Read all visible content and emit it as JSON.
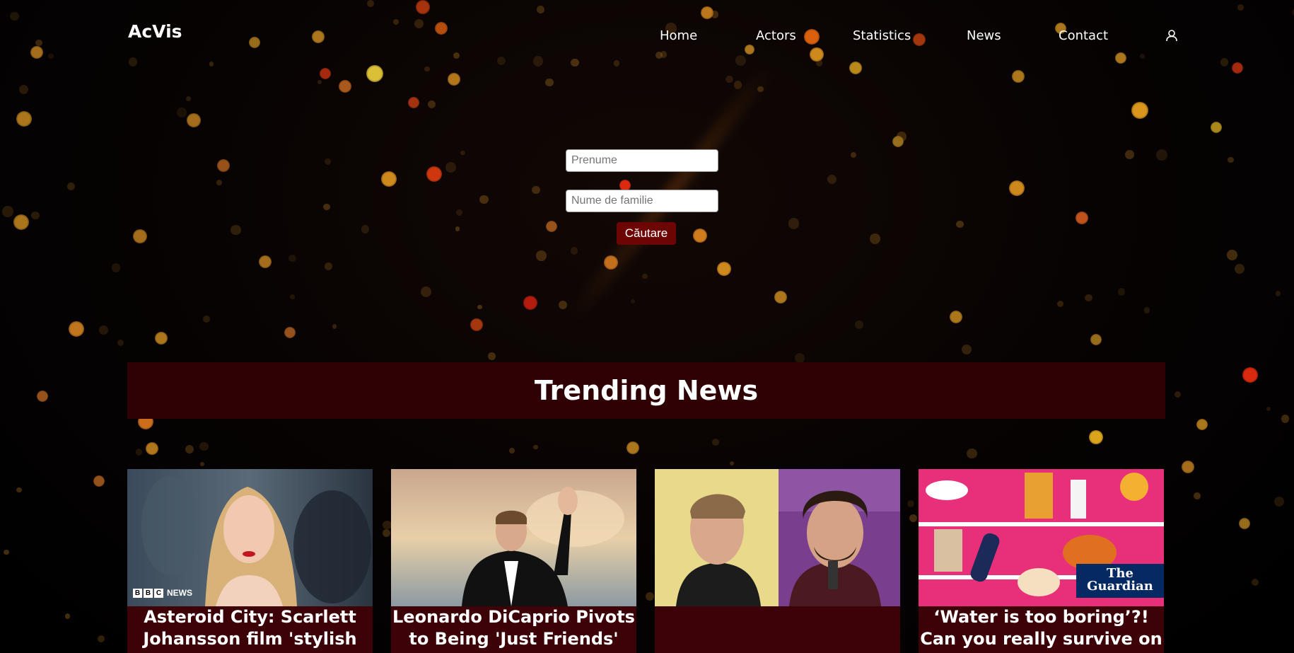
{
  "brand": "AcVis",
  "nav": {
    "items": [
      "Home",
      "Actors",
      "Statistics",
      "News",
      "Contact"
    ],
    "user_icon": "user-icon"
  },
  "search": {
    "first_name_placeholder": "Prenume",
    "last_name_placeholder": "Nume de familie",
    "button_label": "Căutare",
    "button_color": "#6e0505"
  },
  "trending": {
    "heading": "Trending News",
    "banner_color": "#2f0104",
    "cards": [
      {
        "title": "Asteroid City: Scarlett Johansson film 'stylish",
        "source_logo": "BBC NEWS"
      },
      {
        "title": "Leonardo DiCaprio Pivots to Being 'Just Friends'",
        "source_logo": ""
      },
      {
        "title": "",
        "source_logo": ""
      },
      {
        "title": "‘Water is too boring’?! Can you really survive on",
        "source_logo": "The Guardian"
      }
    ]
  }
}
